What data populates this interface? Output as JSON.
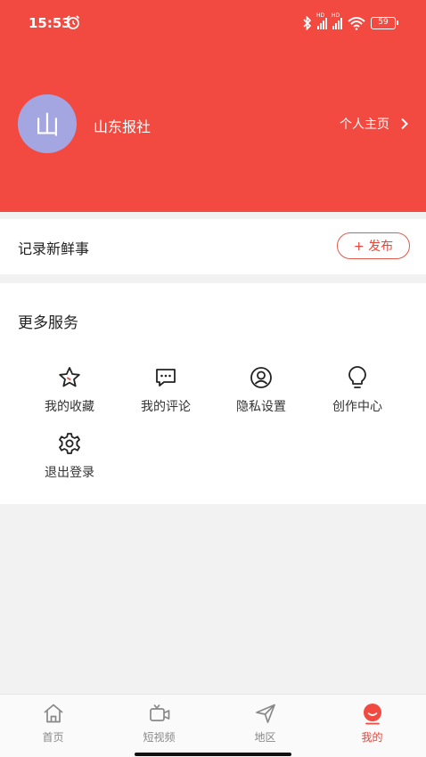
{
  "status_bar": {
    "time": "15:53",
    "battery": "59"
  },
  "profile": {
    "avatar_char": "山",
    "name": "山东报社",
    "homepage_link": "个人主页"
  },
  "record": {
    "label": "记录新鲜事",
    "publish_label": "+ 发布"
  },
  "services": {
    "title": "更多服务",
    "items": [
      {
        "label": "我的收藏",
        "icon": "star-icon"
      },
      {
        "label": "我的评论",
        "icon": "comment-icon"
      },
      {
        "label": "隐私设置",
        "icon": "privacy-icon"
      },
      {
        "label": "创作中心",
        "icon": "bulb-icon"
      },
      {
        "label": "退出登录",
        "icon": "gear-icon"
      }
    ]
  },
  "tabbar": {
    "items": [
      {
        "label": "首页",
        "icon": "home-icon"
      },
      {
        "label": "短视频",
        "icon": "video-icon"
      },
      {
        "label": "地区",
        "icon": "send-icon"
      },
      {
        "label": "我的",
        "icon": "me-icon",
        "active": true
      }
    ]
  },
  "colors": {
    "brand": "#f24a40",
    "accent": "#e0473d",
    "avatar_bg": "#a3a6e0"
  }
}
